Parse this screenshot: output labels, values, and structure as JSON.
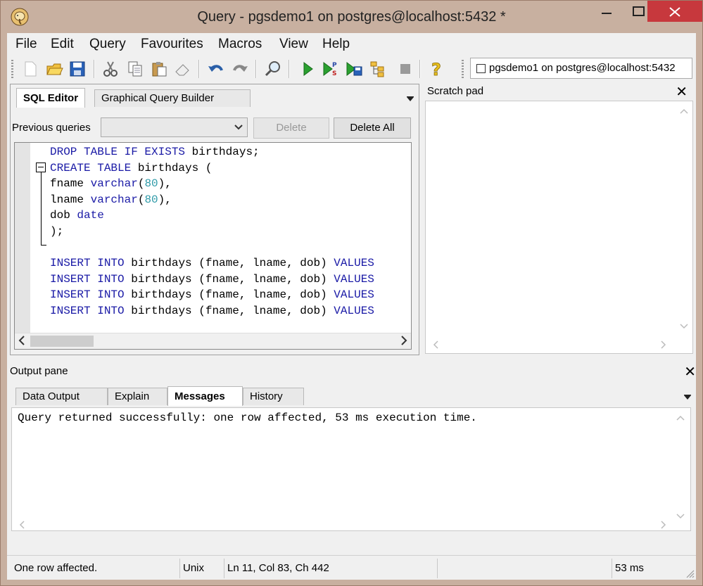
{
  "window": {
    "title": "Query - pgsdemo1 on postgres@localhost:5432 *"
  },
  "menu": [
    "File",
    "Edit",
    "Query",
    "Favourites",
    "Macros",
    "View",
    "Help"
  ],
  "toolbar": {
    "icons": [
      "new-icon",
      "open-icon",
      "save-icon",
      "cut-icon",
      "copy-icon",
      "paste-icon",
      "clear-icon",
      "undo-icon",
      "redo-icon",
      "find-icon",
      "execute-icon",
      "execute-pgscript-icon",
      "execute-to-file-icon",
      "explain-icon",
      "cancel-icon",
      "help-icon"
    ],
    "connection": "pgsdemo1 on postgres@localhost:5432",
    "connection_checked": false
  },
  "editor_panel": {
    "tabs": [
      "SQL Editor",
      "Graphical Query Builder"
    ],
    "active_tab": "SQL Editor",
    "previous_queries_label": "Previous queries",
    "previous_queries_value": "",
    "delete_label": "Delete",
    "delete_all_label": "Delete All"
  },
  "code_lines": [
    [
      [
        "kw",
        "DROP TABLE IF EXISTS"
      ],
      [
        "t",
        " birthdays;"
      ]
    ],
    [
      [
        "kw",
        "CREATE TABLE"
      ],
      [
        "t",
        " birthdays ("
      ]
    ],
    [
      [
        "t",
        "fname "
      ],
      [
        "kw",
        "varchar"
      ],
      [
        "t",
        "("
      ],
      [
        "num",
        "80"
      ],
      [
        "t",
        "),"
      ]
    ],
    [
      [
        "t",
        "lname "
      ],
      [
        "kw",
        "varchar"
      ],
      [
        "t",
        "("
      ],
      [
        "num",
        "80"
      ],
      [
        "t",
        "),"
      ]
    ],
    [
      [
        "t",
        "dob "
      ],
      [
        "kw",
        "date"
      ]
    ],
    [
      [
        "t",
        ");"
      ]
    ],
    [
      [
        "t",
        ""
      ]
    ],
    [
      [
        "kw",
        "INSERT INTO"
      ],
      [
        "t",
        " birthdays (fname, lname, dob) "
      ],
      [
        "kw",
        "VALUES"
      ]
    ],
    [
      [
        "kw",
        "INSERT INTO"
      ],
      [
        "t",
        " birthdays (fname, lname, dob) "
      ],
      [
        "kw",
        "VALUES"
      ]
    ],
    [
      [
        "kw",
        "INSERT INTO"
      ],
      [
        "t",
        " birthdays (fname, lname, dob) "
      ],
      [
        "kw",
        "VALUES"
      ]
    ],
    [
      [
        "kw",
        "INSERT INTO"
      ],
      [
        "t",
        " birthdays (fname, lname, dob) "
      ],
      [
        "kw",
        "VALUES"
      ]
    ]
  ],
  "scratch_pad": {
    "title": "Scratch pad",
    "close": "✕"
  },
  "output_pane": {
    "title": "Output pane",
    "close": "✕",
    "tabs": [
      "Data Output",
      "Explain",
      "Messages",
      "History"
    ],
    "active_tab": "Messages",
    "message": "Query returned successfully: one row affected, 53 ms execution time."
  },
  "status": {
    "message": "One row affected.",
    "line_endings": "Unix",
    "position": "Ln 11, Col 83, Ch 442",
    "time": "53 ms"
  },
  "colors": {
    "title_bg": "#c8b0a0",
    "close_button": "#c7383d",
    "keyword": "#1a1aa6",
    "number": "#2e9aa8"
  }
}
